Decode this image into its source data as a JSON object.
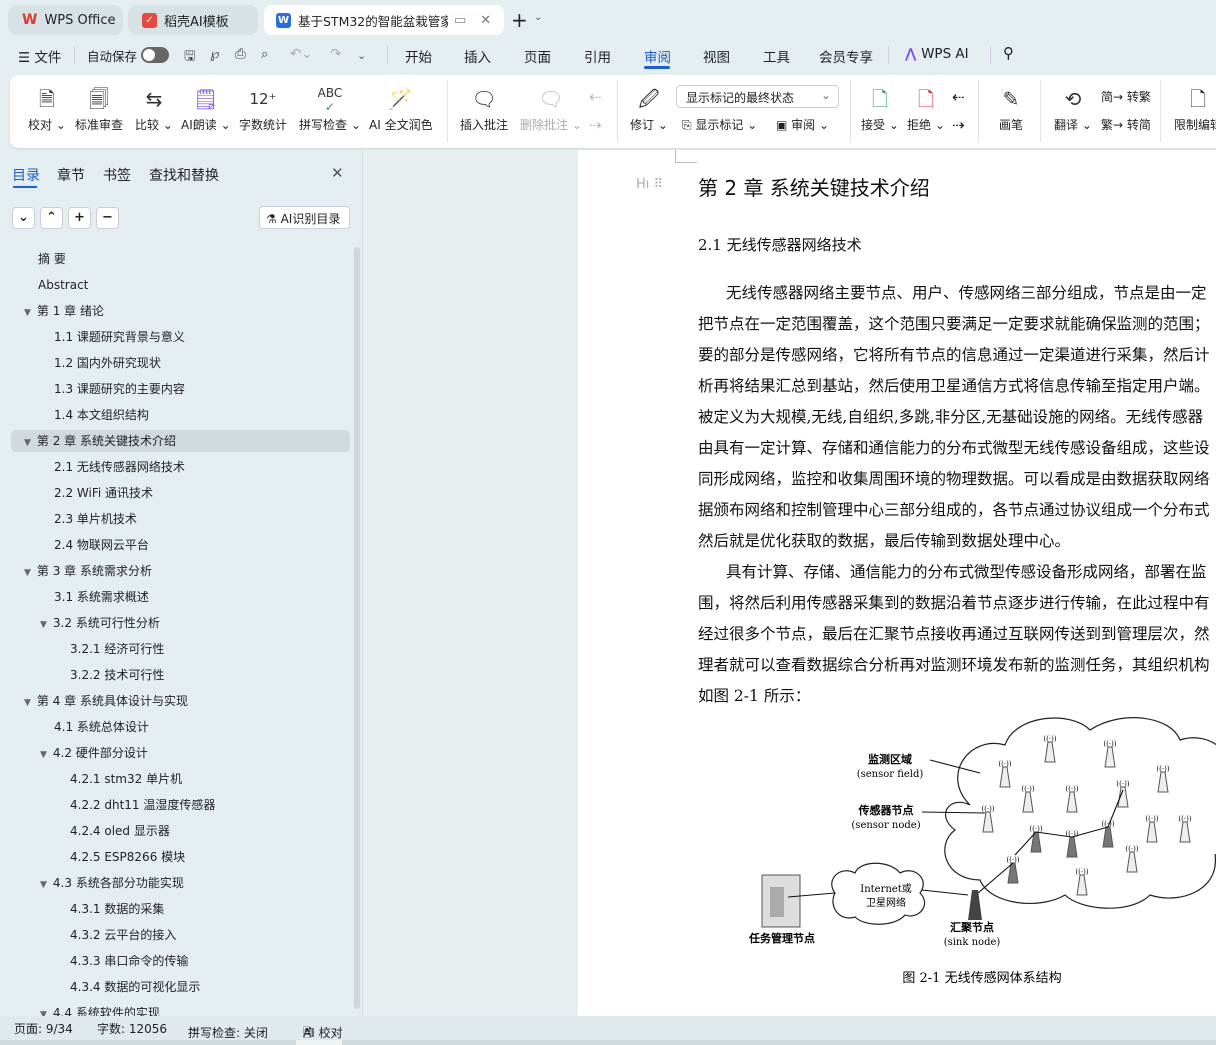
{
  "tabs": [
    {
      "label": "WPS Office",
      "icon": "wps-logo-icon"
    },
    {
      "label": "稻壳AI模板",
      "icon": "docer-logo-icon"
    },
    {
      "label": "基于STM32的智能盆栽管家系",
      "icon": "writer-doc-icon",
      "active": true
    }
  ],
  "menubar": {
    "file": "文件",
    "autosave": "自动保存",
    "autosave_on": false,
    "items": [
      "开始",
      "插入",
      "页面",
      "引用",
      "审阅",
      "视图",
      "工具",
      "会员专享"
    ],
    "active": "审阅",
    "wps_ai": "WPS AI"
  },
  "ribbon": {
    "proofread": "校对",
    "standard_review": "标准审查",
    "compare": "比较",
    "ai_read": "AI朗读",
    "word_count": "字数统计",
    "spell_check": "拼写检查",
    "ai_polish": "AI 全文润色",
    "insert_comment": "插入批注",
    "delete_comment": "删除批注",
    "revise": "修订",
    "display_select": "显示标记的最终状态",
    "show_markup": "显示标记",
    "review": "审阅",
    "accept": "接受",
    "reject": "拒绝",
    "pen": "画笔",
    "translate": "翻译",
    "to_traditional": "转繁",
    "to_simplified": "转简",
    "restrict_edit": "限制编辑"
  },
  "nav_panel": {
    "tabs": [
      "目录",
      "章节",
      "书签",
      "查找和替换"
    ],
    "active_tab": "目录",
    "ai_toc": "AI识别目录",
    "toc": [
      {
        "label": "摘  要",
        "level": 0
      },
      {
        "label": "Abstract",
        "level": 0
      },
      {
        "label": "第 1 章  绪论",
        "level": 0,
        "expanded": true
      },
      {
        "label": "1.1  课题研究背景与意义",
        "level": 1
      },
      {
        "label": "1.2  国内外研究现状",
        "level": 1
      },
      {
        "label": "1.3  课题研究的主要内容",
        "level": 1
      },
      {
        "label": "1.4  本文组织结构",
        "level": 1
      },
      {
        "label": "第 2 章  系统关键技术介绍",
        "level": 0,
        "expanded": true,
        "selected": true
      },
      {
        "label": "2.1  无线传感器网络技术",
        "level": 1
      },
      {
        "label": "2.2 WiFi 通讯技术",
        "level": 1
      },
      {
        "label": "2.3  单片机技术",
        "level": 1
      },
      {
        "label": "2.4  物联网云平台",
        "level": 1
      },
      {
        "label": "第 3 章  系统需求分析",
        "level": 0,
        "expanded": true
      },
      {
        "label": "3.1  系统需求概述",
        "level": 1
      },
      {
        "label": "3.2  系统可行性分析",
        "level": 1,
        "expanded": true
      },
      {
        "label": "3.2.1  经济可行性",
        "level": 2
      },
      {
        "label": "3.2.2  技术可行性",
        "level": 2
      },
      {
        "label": "第 4 章  系统具体设计与实现",
        "level": 0,
        "expanded": true
      },
      {
        "label": "4.1  系统总体设计",
        "level": 1
      },
      {
        "label": "4.2  硬件部分设计",
        "level": 1,
        "expanded": true
      },
      {
        "label": "4.2.1 stm32 单片机",
        "level": 2
      },
      {
        "label": "4.2.2 dht11 温湿度传感器",
        "level": 2
      },
      {
        "label": "4.2.4 oled 显示器",
        "level": 2
      },
      {
        "label": "4.2.5 ESP8266 模块",
        "level": 2
      },
      {
        "label": "4.3  系统各部分功能实现",
        "level": 1,
        "expanded": true
      },
      {
        "label": "4.3.1 数据的采集",
        "level": 2
      },
      {
        "label": "4.3.2 云平台的接入",
        "level": 2
      },
      {
        "label": "4.3.3  串口命令的传输",
        "level": 2
      },
      {
        "label": "4.3.4 数据的可视化显示",
        "level": 2
      },
      {
        "label": "4.4  系统软件的实现",
        "level": 1,
        "expanded": true
      }
    ]
  },
  "document": {
    "heading": "第 2 章  系统关键技术介绍",
    "section": "2.1  无线传感器网络技术",
    "lines": [
      "无线传感器网络主要节点、用户、传感网络三部分组成，节点是由一定",
      "把节点在一定范围覆盖，这个范围只要满足一定要求就能确保监测的范围；",
      "要的部分是传感网络，它将所有节点的信息通过一定渠道进行采集，然后计",
      "析再将结果汇总到基站，然后使用卫星通信方式将信息传输至指定用户端。",
      "被定义为大规模,无线,自组织,多跳,非分区,无基础设施的网络。无线传感器",
      "由具有一定计算、存储和通信能力的分布式微型无线传感设备组成，这些设",
      "同形成网络，监控和收集周围环境的物理数据。可以看成是由数据获取网络",
      "据颁布网络和控制管理中心三部分组成的，各节点通过协议组成一个分布式",
      "然后就是优化获取的数据，最后传输到数据处理中心。",
      "具有计算、存储、通信能力的分布式微型传感设备形成网络，部署在监",
      "围，将然后利用传感器采集到的数据沿着节点逐步进行传输，在此过程中有",
      "经过很多个节点，最后在汇聚节点接收再通过互联网传送到到管理层次，然",
      "理者就可以查看数据综合分析再对监测环境发布新的监测任务，其组织机构",
      "如图 2-1 所示："
    ],
    "figure": {
      "sensor_field": "监测区域",
      "sensor_field_en": "(sensor field)",
      "sensor_node": "传感器节点",
      "sensor_node_en": "(sensor node)",
      "internet_1": "Internet或",
      "internet_2": "卫星网络",
      "task_node": "任务管理节点",
      "sink_node": "汇聚节点",
      "sink_node_en": "(sink node)",
      "caption": "图 2-1  无线传感网体系结构"
    }
  },
  "status": {
    "page": "页面: 9/34",
    "words": "字数: 12056",
    "spell": "拼写检查: 关闭",
    "ai_proof": "AI 校对"
  }
}
